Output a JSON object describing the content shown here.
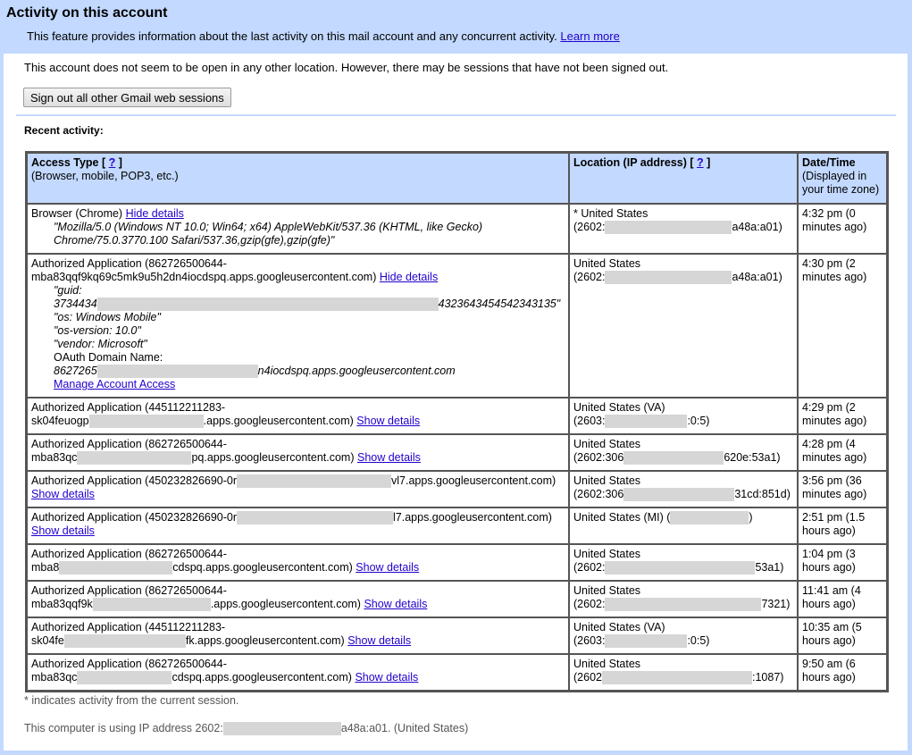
{
  "header": {
    "title": "Activity on this account",
    "subtitle": "This feature provides information about the last activity on this mail account and any concurrent activity.",
    "learn_more": "Learn more"
  },
  "notice": "This account does not seem to be open in any other location. However, there may be sessions that have not been signed out.",
  "signout_button": "Sign out all other Gmail web sessions",
  "recent_label": "Recent activity:",
  "table": {
    "headers": {
      "access_type": "Access Type [",
      "access_type_help": "?",
      "access_type_close": "]",
      "access_type_sub": "(Browser, mobile, POP3, etc.)",
      "location": "Location (IP address) [",
      "location_help": "?",
      "location_close": "]",
      "datetime": "Date/Time",
      "datetime_sub": "(Displayed in your time zone)"
    },
    "rows": [
      {
        "access": "Browser (Chrome)",
        "link": "Hide details",
        "ua1": "\"Mozilla/5.0 (Windows NT 10.0; Win64; x64) AppleWebKit/537.36 (KHTML, like Gecko)",
        "ua2": "Chrome/75.0.3770.100 Safari/537.36,gzip(gfe),gzip(gfe)\"",
        "loc": "* United States",
        "ip_pre": "(2602:",
        "ip_post": "a48a:a01)",
        "time": "4:32 pm (0 minutes ago)"
      },
      {
        "access1": "Authorized Application (862726500644-",
        "access2": "mba83qqf9kq69c5mk9u5h2dn4iocdspq.apps.googleusercontent.com)",
        "link": "Hide details",
        "guid_label": "\"guid:",
        "guid_pre": "3734434",
        "guid_post": "4323643454542343135\"",
        "os": "\"os: Windows Mobile\"",
        "os_version": "\"os-version: 10.0\"",
        "vendor": "\"vendor: Microsoft\"",
        "oauth_label": "OAuth Domain Name:",
        "oauth_pre": "8627265",
        "oauth_post": "n4iocdspq.apps.googleusercontent.com",
        "manage": "Manage Account Access",
        "loc": "United States",
        "ip_pre": "(2602:",
        "ip_post": "a48a:a01)",
        "time": "4:30 pm (2 minutes ago)"
      },
      {
        "access1": "Authorized Application (445112211283-",
        "access2_pre": "sk04feuogp",
        "access2_post": ".apps.googleusercontent.com)",
        "link": "Show details",
        "loc": "United States (VA)",
        "ip_pre": "(2603:",
        "ip_post": ":0:5)",
        "time": "4:29 pm (2 minutes ago)"
      },
      {
        "access1": "Authorized Application (862726500644-",
        "access2_pre": "mba83qc",
        "access2_post": "pq.apps.googleusercontent.com)",
        "link": "Show details",
        "loc": "United States",
        "ip_pre": "(2602:306",
        "ip_post": "620e:53a1)",
        "time": "4:28 pm (4 minutes ago)"
      },
      {
        "access1_pre": "Authorized Application (450232826690-0r",
        "access1_post": "vl7.apps.googleusercontent.com)",
        "link": "Show details",
        "loc": "United States",
        "ip_pre": "(2602:306",
        "ip_post": "31cd:851d)",
        "time": "3:56 pm (36 minutes ago)"
      },
      {
        "access1_pre": "Authorized Application (450232826690-0r",
        "access1_post": "l7.apps.googleusercontent.com)",
        "link": "Show details",
        "loc_pre": "United States (MI) (",
        "loc_post": ")",
        "time": "2:51 pm (1.5 hours ago)"
      },
      {
        "access1": "Authorized Application (862726500644-",
        "access2_pre": "mba8",
        "access2_post": "cdspq.apps.googleusercontent.com)",
        "link": "Show details",
        "loc": "United States",
        "ip_pre": "(2602:",
        "ip_post": "53a1)",
        "time": "1:04 pm (3 hours ago)"
      },
      {
        "access1": "Authorized Application (862726500644-",
        "access2_pre": "mba83qqf9k",
        "access2_post": ".apps.googleusercontent.com)",
        "link": "Show details",
        "loc": "United States",
        "ip_pre": "(2602:",
        "ip_post": "7321)",
        "time": "11:41 am (4 hours ago)"
      },
      {
        "access1": "Authorized Application (445112211283-",
        "access2_pre": "sk04fe",
        "access2_post": "fk.apps.googleusercontent.com)",
        "link": "Show details",
        "loc": "United States (VA)",
        "ip_pre": "(2603:",
        "ip_post": ":0:5)",
        "time": "10:35 am (5 hours ago)"
      },
      {
        "access1": "Authorized Application (862726500644-",
        "access2_pre": "mba83qc",
        "access2_post": "cdspq.apps.googleusercontent.com)",
        "link": "Show details",
        "loc": "United States",
        "ip_pre": "(2602",
        "ip_post": ":1087)",
        "time": "9:50 am (6 hours ago)"
      }
    ]
  },
  "footer": {
    "current_session_note": "* indicates activity from the current session.",
    "ip_pre": "This computer is using IP address 2602:",
    "ip_post": "a48a:a01. (United States)"
  }
}
